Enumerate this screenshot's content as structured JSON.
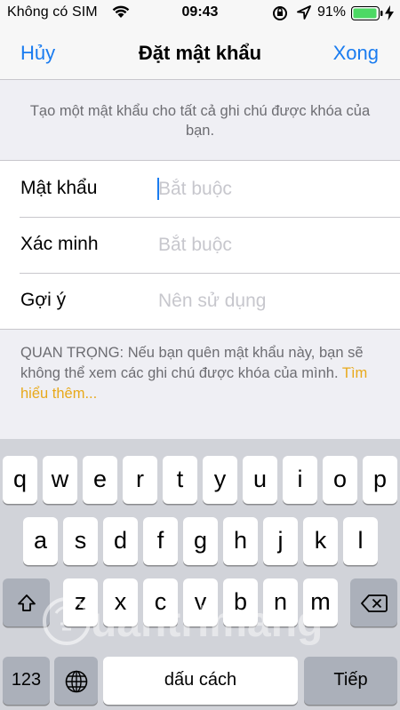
{
  "status_bar": {
    "carrier": "Không có SIM",
    "time": "09:43",
    "battery_percent": "91%"
  },
  "nav": {
    "cancel": "Hủy",
    "title": "Đặt mật khẩu",
    "done": "Xong"
  },
  "description": "Tạo một mật khẩu cho tất cả ghi chú được khóa của bạn.",
  "form": {
    "password_label": "Mật khẩu",
    "password_placeholder": "Bắt buộc",
    "verify_label": "Xác minh",
    "verify_placeholder": "Bắt buộc",
    "hint_label": "Gợi ý",
    "hint_placeholder": "Nên sử dụng"
  },
  "note": {
    "text": "QUAN TRỌNG: Nếu bạn quên mật khẩu này, bạn sẽ không thể xem các ghi chú được khóa của mình. ",
    "link": "Tìm hiểu thêm..."
  },
  "keyboard": {
    "row1": [
      "q",
      "w",
      "e",
      "r",
      "t",
      "y",
      "u",
      "i",
      "o",
      "p"
    ],
    "row2": [
      "a",
      "s",
      "d",
      "f",
      "g",
      "h",
      "j",
      "k",
      "l"
    ],
    "row3": [
      "z",
      "x",
      "c",
      "v",
      "b",
      "n",
      "m"
    ],
    "numbers_key": "123",
    "space_key": "dấu cách",
    "return_key": "Tiếp",
    "shift_icon": "shift-icon",
    "delete_icon": "backspace-icon",
    "globe_icon": "globe-icon"
  },
  "colors": {
    "accent": "#1a7cf0",
    "link": "#e8a91b",
    "keyboard_bg": "#d1d3d9"
  }
}
